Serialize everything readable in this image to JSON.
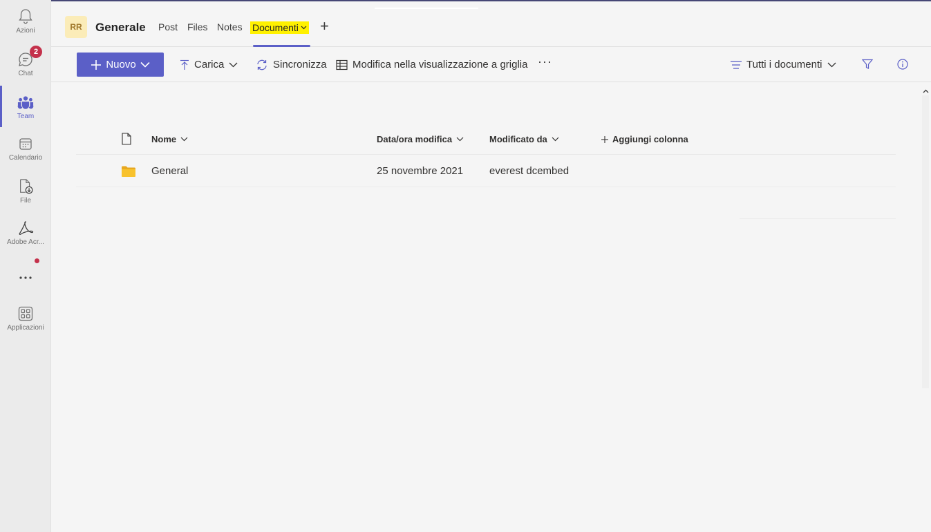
{
  "rail": {
    "items": [
      {
        "label": "Azioni",
        "icon": "bell-icon"
      },
      {
        "label": "Chat",
        "icon": "chat-icon",
        "badge": "2"
      },
      {
        "label": "Team",
        "icon": "teams-icon",
        "active": true
      },
      {
        "label": "Calendario",
        "icon": "calendar-icon"
      },
      {
        "label": "File",
        "icon": "file-download-icon"
      },
      {
        "label": "Adobe Acr...",
        "icon": "adobe-acrobat-icon"
      },
      {
        "label": "",
        "icon": "more-icon"
      },
      {
        "label": "Applicazioni",
        "icon": "apps-icon"
      }
    ]
  },
  "header": {
    "team_initials": "RR",
    "channel_name": "Generale",
    "tabs": [
      {
        "label": "Post"
      },
      {
        "label": "Files"
      },
      {
        "label": "Notes"
      },
      {
        "label": "Documenti",
        "active": true
      }
    ],
    "add_tab_label": "+"
  },
  "toolbar": {
    "new_label": "Nuovo",
    "upload_label": "Carica",
    "sync_label": "Sincronizza",
    "grid_edit_label": "Modifica nella visualizzazione a griglia",
    "more_label": "···",
    "view_label": "Tutti i documenti"
  },
  "list": {
    "columns": {
      "name": "Nome",
      "modified": "Data/ora modifica",
      "modified_by": "Modificato da",
      "add_column": "Aggiungi colonna"
    },
    "rows": [
      {
        "name": "General",
        "modified": "25 novembre 2021",
        "modified_by": "everest dcembed",
        "type": "folder"
      }
    ]
  },
  "colors": {
    "accent": "#5b5fc7",
    "badge": "#c4314b",
    "highlight": "#fff100",
    "folder": "#f8c22d"
  }
}
